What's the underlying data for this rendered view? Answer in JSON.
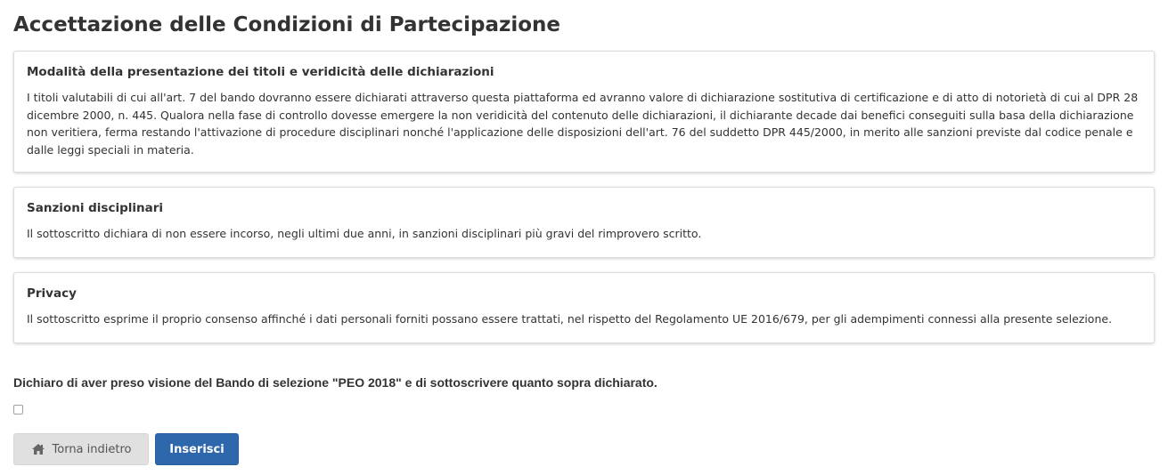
{
  "page": {
    "title": "Accettazione delle Condizioni di Partecipazione"
  },
  "sections": [
    {
      "title": "Modalità della presentazione dei titoli e veridicità delle dichiarazioni",
      "text": "I titoli valutabili di cui all'art. 7 del bando dovranno essere dichiarati attraverso questa piattaforma ed avranno valore di dichiarazione sostitutiva di certificazione e di atto di notorietà di cui al DPR 28 dicembre 2000, n. 445. Qualora nella fase di controllo dovesse emergere la non veridicità del contenuto delle dichiarazioni, il dichiarante decade dai benefici conseguiti sulla basa della dichiarazione non veritiera, ferma restando l'attivazione di procedure disciplinari nonché l'applicazione delle disposizioni dell'art. 76 del suddetto DPR 445/2000, in merito alle sanzioni previste dal codice penale e dalle leggi speciali in materia."
    },
    {
      "title": "Sanzioni disciplinari",
      "text": "Il sottoscritto dichiara di non essere incorso, negli ultimi due anni, in sanzioni disciplinari più gravi del rimprovero scritto."
    },
    {
      "title": "Privacy",
      "text": "Il sottoscritto esprime il proprio consenso affinché i dati personali forniti possano essere trattati, nel rispetto del Regolamento UE 2016/679, per gli adempimenti connessi alla presente selezione."
    }
  ],
  "declaration": {
    "text": "Dichiaro di aver preso visione del Bando di selezione \"PEO 2018\" e di sottoscrivere quanto sopra dichiarato.",
    "checked": false
  },
  "buttons": {
    "back_label": "Torna indietro",
    "back_icon": "home-icon",
    "submit_label": "Inserisci"
  },
  "colors": {
    "primary": "#2f67ad",
    "secondary": "#e0e0e0"
  }
}
